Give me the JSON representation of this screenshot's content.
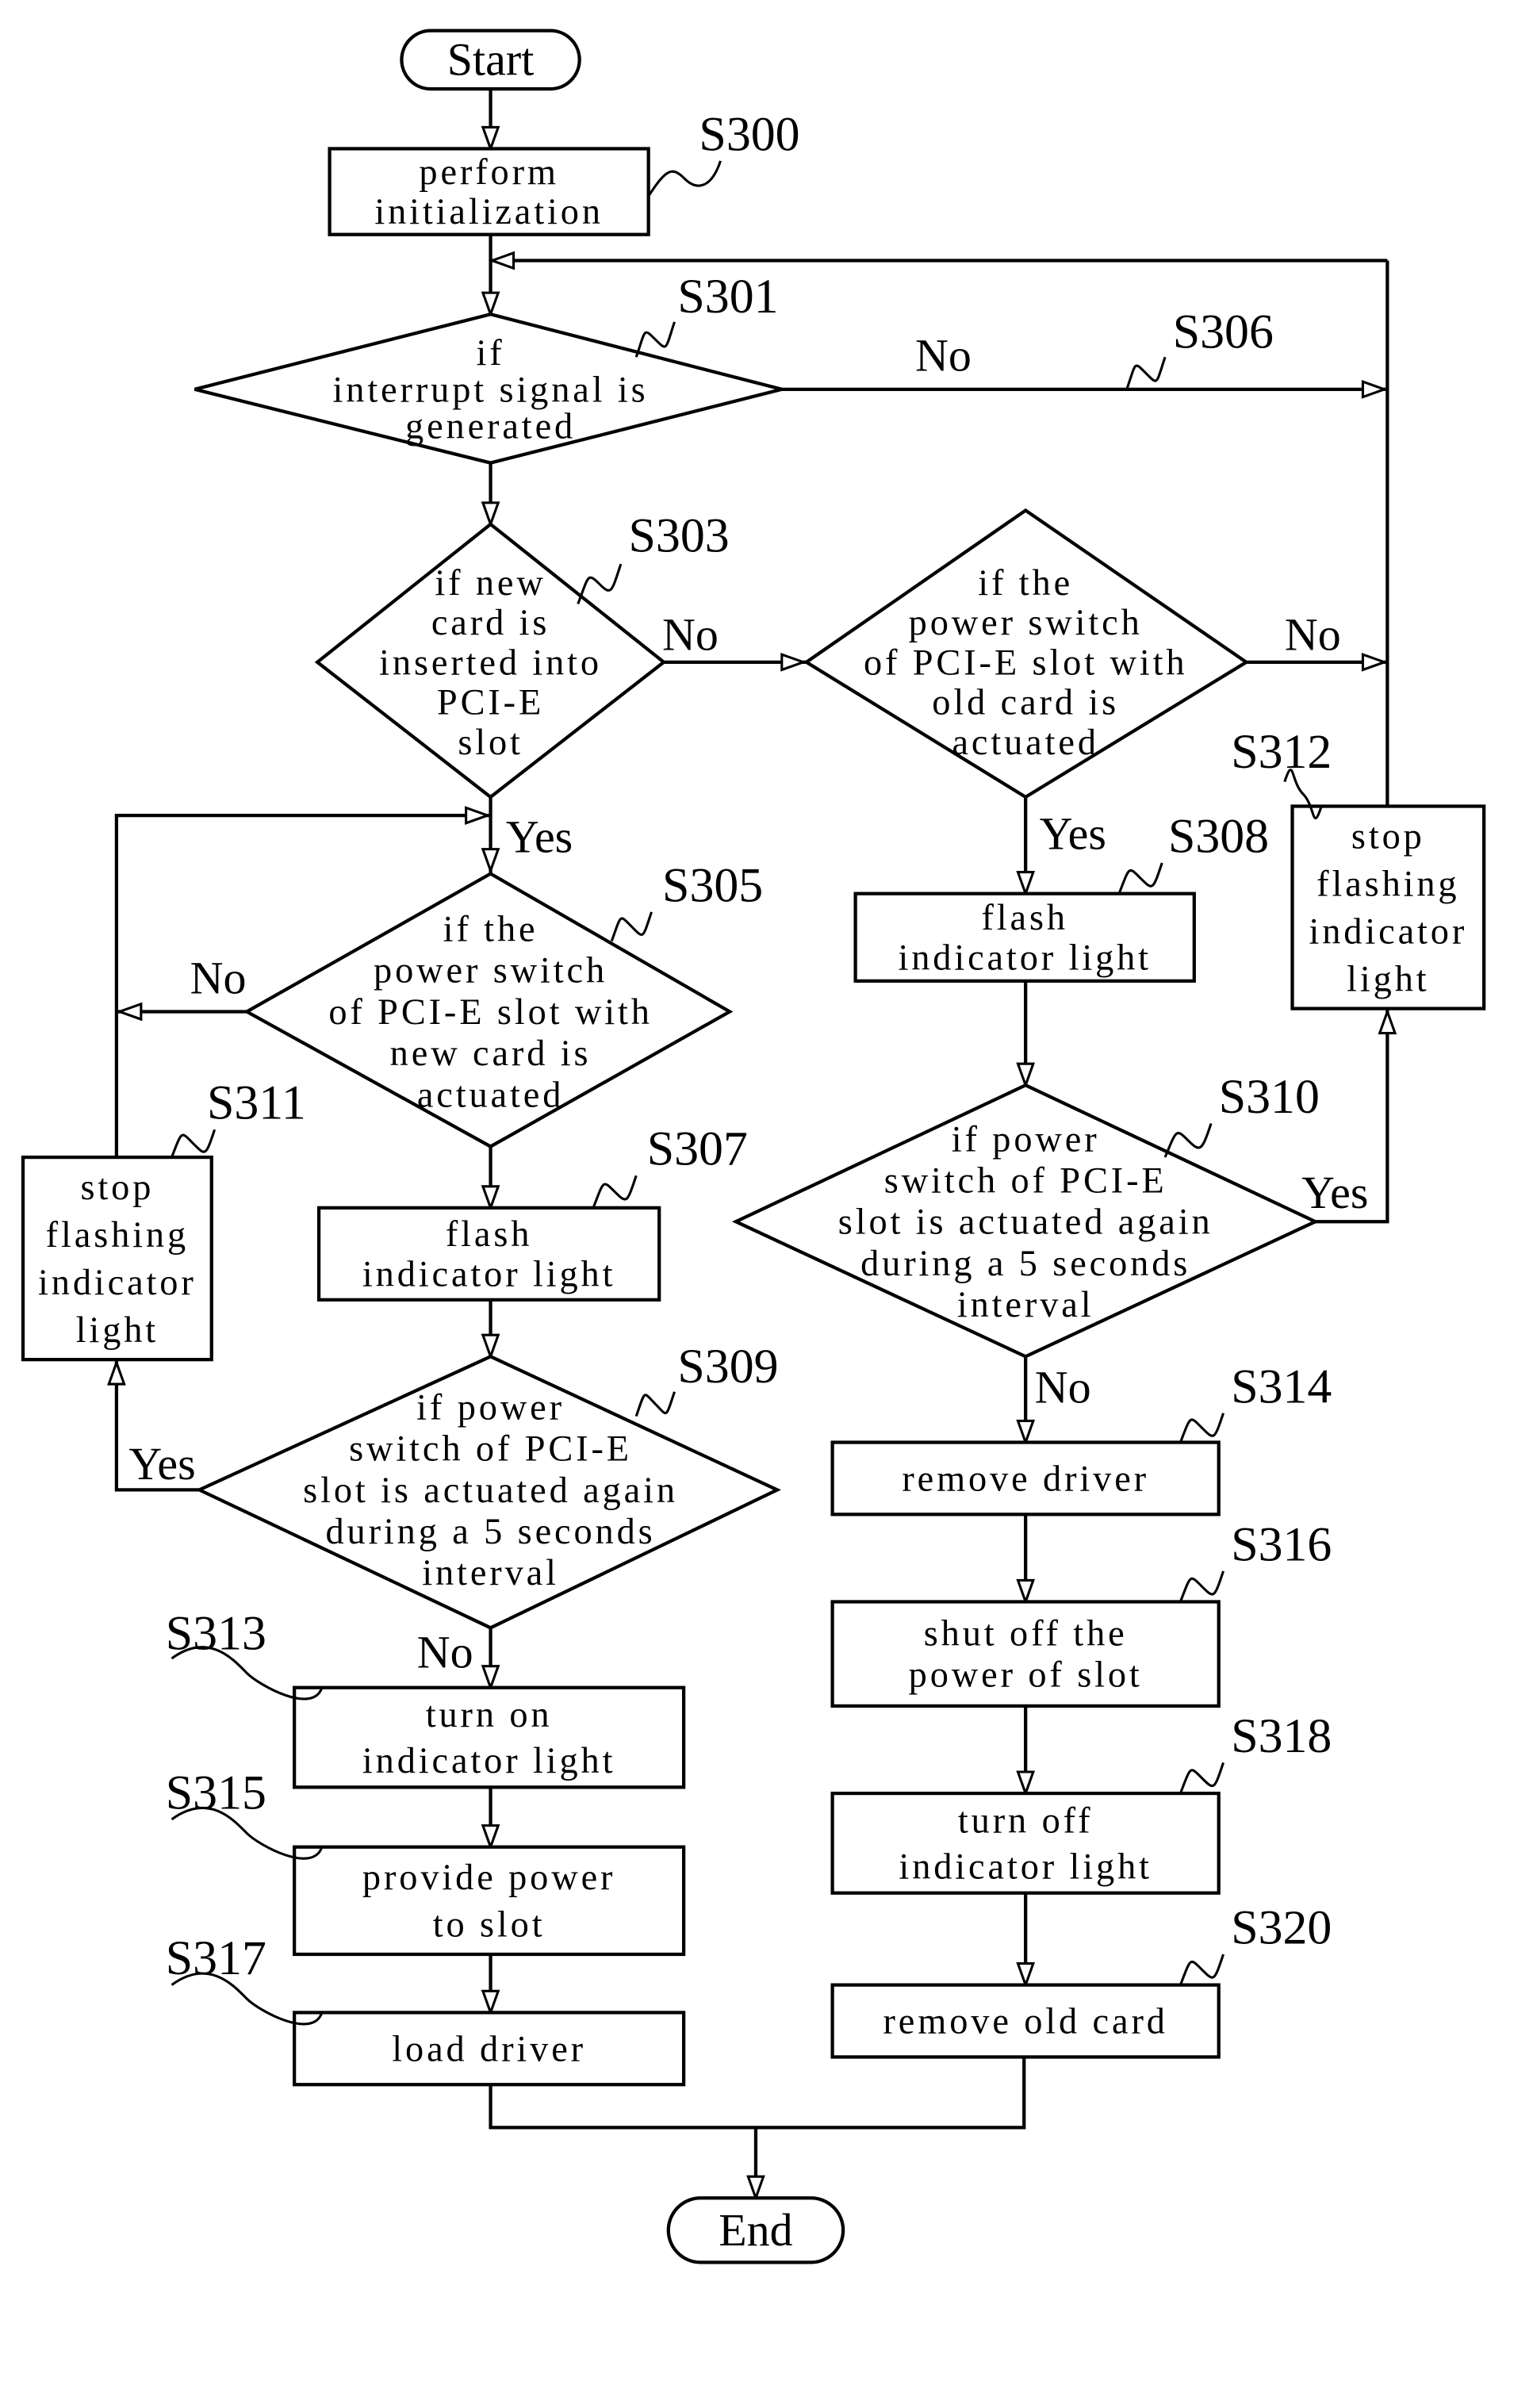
{
  "diagram": {
    "type": "flowchart",
    "terminals": {
      "start": "Start",
      "end": "End"
    },
    "nodes": {
      "S300": {
        "ref": "S300",
        "kind": "process",
        "lines": [
          "perform",
          "initialization"
        ]
      },
      "S301": {
        "ref": "S301",
        "kind": "decision",
        "lines": [
          "if",
          "interrupt signal is",
          "generated"
        ]
      },
      "S303": {
        "ref": "S303",
        "kind": "decision",
        "lines": [
          "if new",
          "card is",
          "inserted into",
          "PCI-E",
          "slot"
        ]
      },
      "S304": {
        "ref": "",
        "kind": "decision",
        "lines": [
          "if the",
          "power switch",
          "of PCI-E slot with",
          "old card is",
          "actuated"
        ]
      },
      "S305": {
        "ref": "S305",
        "kind": "decision",
        "lines": [
          "if the",
          "power switch",
          "of PCI-E slot with",
          "new card is",
          "actuated"
        ]
      },
      "S306": {
        "ref": "S306",
        "kind": "connector"
      },
      "S307": {
        "ref": "S307",
        "kind": "process",
        "lines": [
          "flash",
          "indicator light"
        ]
      },
      "S308": {
        "ref": "S308",
        "kind": "process",
        "lines": [
          "flash",
          "indicator light"
        ]
      },
      "S309": {
        "ref": "S309",
        "kind": "decision",
        "lines": [
          "if power",
          "switch of PCI-E",
          "slot is actuated again",
          "during a 5 seconds",
          "interval"
        ]
      },
      "S310": {
        "ref": "S310",
        "kind": "decision",
        "lines": [
          "if power",
          "switch of PCI-E",
          "slot is actuated again",
          "during a 5 seconds",
          "interval"
        ]
      },
      "S311": {
        "ref": "S311",
        "kind": "process",
        "lines": [
          "stop",
          "flashing",
          "indicator",
          "light"
        ]
      },
      "S312": {
        "ref": "S312",
        "kind": "process",
        "lines": [
          "stop",
          "flashing",
          "indicator",
          "light"
        ]
      },
      "S313": {
        "ref": "S313",
        "kind": "process",
        "lines": [
          "turn on",
          "indicator light"
        ]
      },
      "S314": {
        "ref": "S314",
        "kind": "process",
        "lines": [
          "remove driver"
        ]
      },
      "S315": {
        "ref": "S315",
        "kind": "process",
        "lines": [
          "provide power",
          "to slot"
        ]
      },
      "S316": {
        "ref": "S316",
        "kind": "process",
        "lines": [
          "shut off the",
          "power of slot"
        ]
      },
      "S317": {
        "ref": "S317",
        "kind": "process",
        "lines": [
          "load driver"
        ]
      },
      "S318": {
        "ref": "S318",
        "kind": "process",
        "lines": [
          "turn off",
          "indicator light"
        ]
      },
      "S320": {
        "ref": "S320",
        "kind": "process",
        "lines": [
          "remove old card"
        ]
      }
    },
    "edge_labels": {
      "yes": "Yes",
      "no": "No"
    },
    "edges": [
      {
        "from": "start",
        "to": "S300"
      },
      {
        "from": "S300",
        "to": "S301"
      },
      {
        "from": "S301",
        "to": "S303",
        "label": ""
      },
      {
        "from": "S301",
        "to": "S306",
        "label": "No"
      },
      {
        "from": "S303",
        "to": "S305",
        "label": "Yes"
      },
      {
        "from": "S303",
        "to": "S304",
        "label": "No"
      },
      {
        "from": "S304",
        "to": "S308",
        "label": "Yes"
      },
      {
        "from": "S304",
        "to": "S306",
        "label": "No"
      },
      {
        "from": "S305",
        "to": "S307",
        "label": ""
      },
      {
        "from": "S305",
        "to": "S305-loop",
        "label": "No"
      },
      {
        "from": "S307",
        "to": "S309"
      },
      {
        "from": "S309",
        "to": "S311",
        "label": "Yes"
      },
      {
        "from": "S309",
        "to": "S313",
        "label": "No"
      },
      {
        "from": "S311",
        "to": "S305"
      },
      {
        "from": "S313",
        "to": "S315"
      },
      {
        "from": "S315",
        "to": "S317"
      },
      {
        "from": "S317",
        "to": "end"
      },
      {
        "from": "S308",
        "to": "S310"
      },
      {
        "from": "S310",
        "to": "S312",
        "label": "Yes"
      },
      {
        "from": "S310",
        "to": "S314",
        "label": "No"
      },
      {
        "from": "S312",
        "to": "S306"
      },
      {
        "from": "S306",
        "to": "S301"
      },
      {
        "from": "S314",
        "to": "S316"
      },
      {
        "from": "S316",
        "to": "S318"
      },
      {
        "from": "S318",
        "to": "S320"
      },
      {
        "from": "S320",
        "to": "end"
      }
    ]
  }
}
